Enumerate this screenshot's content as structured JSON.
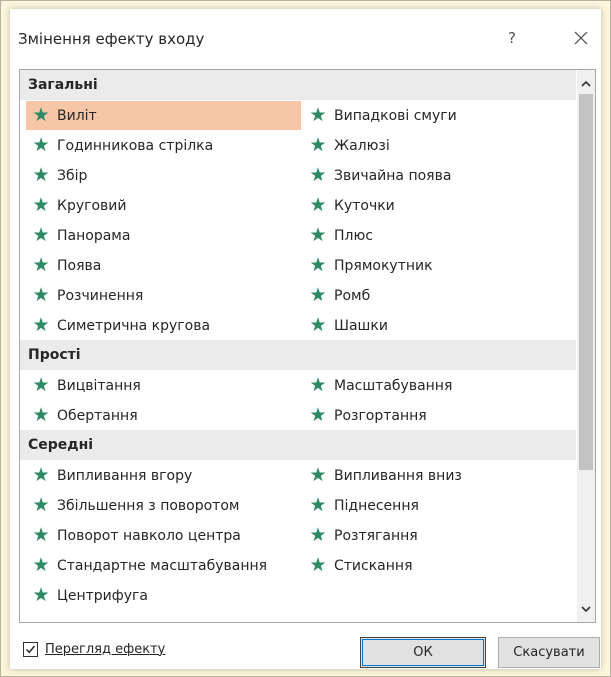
{
  "window": {
    "title": "Змінення ефекту входу",
    "help_label": "?",
    "close_icon": "close-icon"
  },
  "colors": {
    "star": "#2e8a62",
    "selected_bg": "#f7c6a6",
    "group_bg": "#ebebeb"
  },
  "groups": [
    {
      "label": "Загальні",
      "effects": [
        {
          "label": "Виліт",
          "selected": true
        },
        {
          "label": "Випадкові смуги"
        },
        {
          "label": "Годинникова стрілка"
        },
        {
          "label": "Жалюзі"
        },
        {
          "label": "Збір"
        },
        {
          "label": "Звичайна поява"
        },
        {
          "label": "Круговий"
        },
        {
          "label": "Куточки"
        },
        {
          "label": "Панорама"
        },
        {
          "label": "Плюс"
        },
        {
          "label": "Поява"
        },
        {
          "label": "Прямокутник"
        },
        {
          "label": "Розчинення"
        },
        {
          "label": "Ромб"
        },
        {
          "label": "Симетрична кругова"
        },
        {
          "label": "Шашки"
        }
      ]
    },
    {
      "label": "Прості",
      "effects": [
        {
          "label": "Вицвітання"
        },
        {
          "label": "Масштабування"
        },
        {
          "label": "Обертання"
        },
        {
          "label": "Розгортання"
        }
      ]
    },
    {
      "label": "Середні",
      "effects": [
        {
          "label": "Випливання вгору"
        },
        {
          "label": "Випливання вниз"
        },
        {
          "label": "Збільшення з поворотом"
        },
        {
          "label": "Піднесення"
        },
        {
          "label": "Поворот навколо центра"
        },
        {
          "label": "Розтягання"
        },
        {
          "label": "Стандартне масштабування"
        },
        {
          "label": "Стискання"
        },
        {
          "label": "Центрифуга"
        }
      ]
    }
  ],
  "preview": {
    "label": "Перегляд ефекту",
    "checked": true
  },
  "buttons": {
    "ok": "ОК",
    "cancel": "Скасувати"
  }
}
